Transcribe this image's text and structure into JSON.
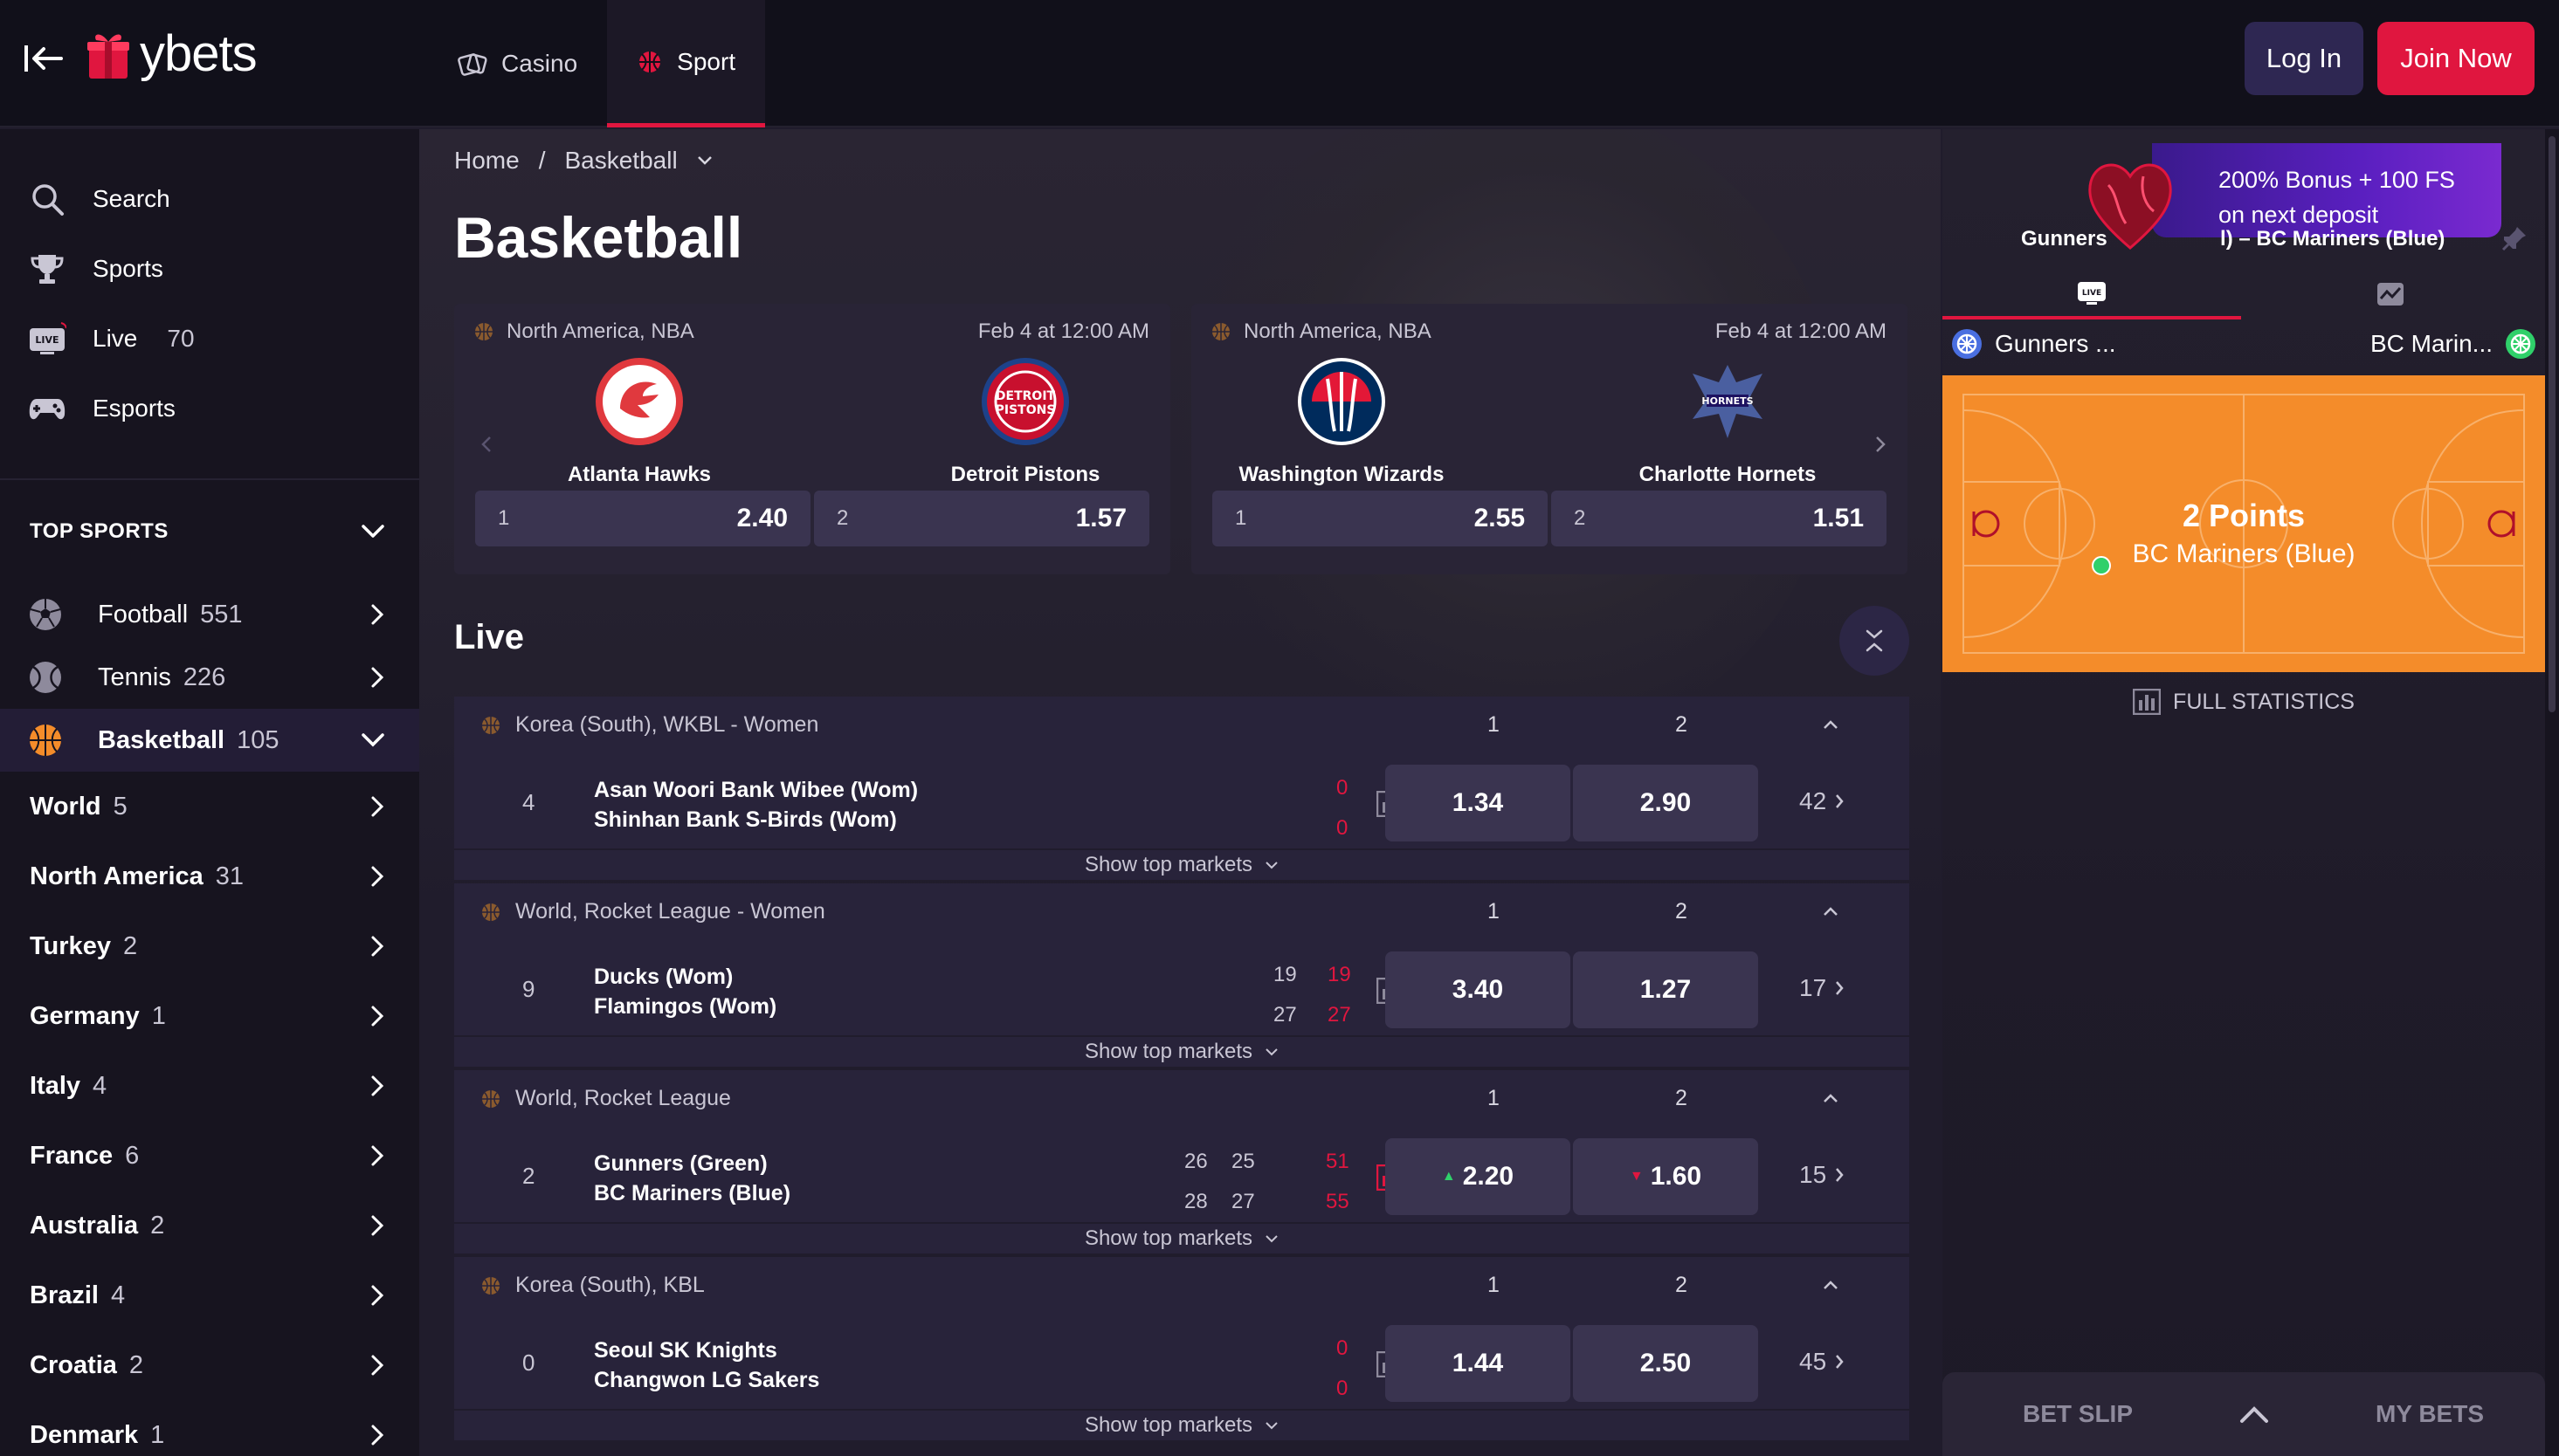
{
  "brand": {
    "name": "ybets"
  },
  "topnav": [
    {
      "label": "Casino",
      "active": false
    },
    {
      "label": "Sport",
      "active": true
    }
  ],
  "auth": {
    "login": "Log In",
    "join": "Join Now"
  },
  "sidebar": {
    "main": [
      {
        "label": "Search",
        "icon": "search-icon"
      },
      {
        "label": "Sports",
        "icon": "trophy-icon"
      },
      {
        "label": "Live",
        "count": "70",
        "icon": "live-tv-icon"
      },
      {
        "label": "Esports",
        "icon": "gamepad-icon"
      }
    ],
    "top_sports_label": "TOP SPORTS",
    "sports": [
      {
        "label": "Football",
        "count": "551",
        "icon": "football-icon"
      },
      {
        "label": "Tennis",
        "count": "226",
        "icon": "tennis-icon"
      },
      {
        "label": "Basketball",
        "count": "105",
        "icon": "basketball-icon"
      }
    ],
    "regions": [
      {
        "label": "World",
        "count": "5"
      },
      {
        "label": "North America",
        "count": "31"
      },
      {
        "label": "Turkey",
        "count": "2"
      },
      {
        "label": "Germany",
        "count": "1"
      },
      {
        "label": "Italy",
        "count": "4"
      },
      {
        "label": "France",
        "count": "6"
      },
      {
        "label": "Australia",
        "count": "2"
      },
      {
        "label": "Brazil",
        "count": "4"
      },
      {
        "label": "Croatia",
        "count": "2"
      },
      {
        "label": "Denmark",
        "count": "1"
      }
    ]
  },
  "breadcrumb": {
    "home": "Home",
    "sep": "/",
    "current": "Basketball"
  },
  "page_title": "Basketball",
  "featured": [
    {
      "league": "North America, NBA",
      "date": "Feb 4 at 12:00 AM",
      "home": "Atlanta Hawks",
      "away": "Detroit Pistons",
      "odds": [
        {
          "label": "1",
          "value": "2.40"
        },
        {
          "label": "2",
          "value": "1.57"
        }
      ]
    },
    {
      "league": "North America, NBA",
      "date": "Feb 4 at 12:00 AM",
      "home": "Washington Wizards",
      "away": "Charlotte Hornets",
      "odds": [
        {
          "label": "1",
          "value": "2.55"
        },
        {
          "label": "2",
          "value": "1.51"
        }
      ]
    }
  ],
  "live_title": "Live",
  "col_labels": {
    "one": "1",
    "two": "2"
  },
  "show_top_markets": "Show top markets",
  "matches": [
    {
      "league": "Korea (South), WKBL - Women",
      "period": "4",
      "home": "Asan Woori Bank Wibee (Wom)",
      "away": "Shinhan Bank S-Birds (Wom)",
      "score_home": "0",
      "score_away": "0",
      "odd1": "1.34",
      "odd2": "2.90",
      "more": "42"
    },
    {
      "league": "World, Rocket League - Women",
      "period": "9",
      "home": "Ducks (Wom)",
      "away": "Flamingos (Wom)",
      "period_home": "19",
      "period_away": "27",
      "score_home": "19",
      "score_away": "27",
      "odd1": "3.40",
      "odd2": "1.27",
      "more": "17"
    },
    {
      "league": "World, Rocket League",
      "period": "2",
      "home": "Gunners (Green)",
      "away": "BC Mariners (Blue)",
      "p1_home": "26",
      "p1_away": "28",
      "p2_home": "25",
      "p2_away": "27",
      "score_home": "51",
      "score_away": "55",
      "odd1": "2.20",
      "odd2": "1.60",
      "more": "15"
    },
    {
      "league": "Korea (South), KBL",
      "period": "0",
      "home": "Seoul SK Knights",
      "away": "Changwon LG Sakers",
      "score_home": "0",
      "score_away": "0",
      "odd1": "1.44",
      "odd2": "2.50",
      "more": "45"
    }
  ],
  "right_panel": {
    "promo": "200% Bonus + 100 FS on next deposit",
    "event_title_left": "Gunners",
    "event_title_right": "l) – BC Mariners (Blue)",
    "home_short": "Gunners ...",
    "away_short": "BC Marin...",
    "court_event": "2 Points",
    "court_team": "BC Mariners (Blue)",
    "full_stats": "FULL STATISTICS",
    "bet_slip": "BET SLIP",
    "my_bets": "MY BETS"
  },
  "colors": {
    "accent": "#e0163f",
    "court": "#f48c2a",
    "login_bg": "#2e2752"
  }
}
